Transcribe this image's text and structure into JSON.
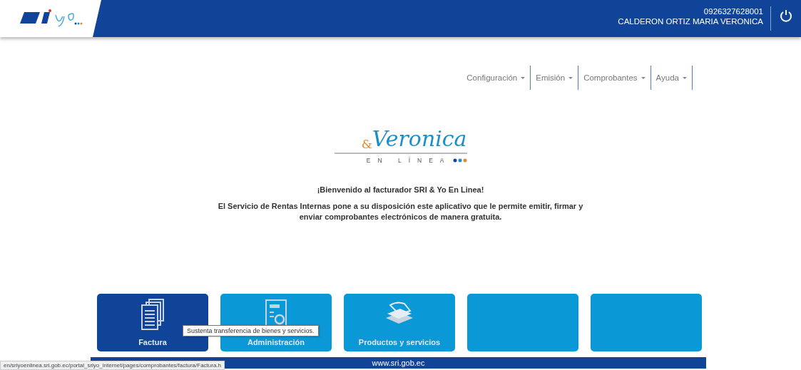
{
  "header": {
    "ruc": "0926327628001",
    "user_name": "CALDERON ORTIZ MARIA VERONICA"
  },
  "menu": [
    {
      "label": "Configuración"
    },
    {
      "label": "Emisión"
    },
    {
      "label": "Comprobantes"
    },
    {
      "label": "Ayuda"
    }
  ],
  "logo": {
    "amp": "&",
    "name": "Veronica",
    "tagline": "EN LÍNEA"
  },
  "welcome": {
    "title": "¡Bienvenido al facturador SRI & Yo En Linea!",
    "text": "El Servicio de Rentas Internas pone a su disposición este aplicativo que le permite emitir, firmar y enviar comprobantes electrónicos de manera gratuita."
  },
  "tiles": [
    {
      "kind": "documents",
      "label": "Factura",
      "selected": true
    },
    {
      "kind": "admin",
      "label": "Administración",
      "selected": false
    },
    {
      "kind": "papers",
      "label": "Productos y servicios",
      "selected": false
    },
    {
      "kind": "empty",
      "selected": false
    },
    {
      "kind": "empty",
      "selected": false
    }
  ],
  "tooltip": "Sustenta transferencia de bienes y servicios.",
  "footer": "www.sri.gob.ec",
  "status_url": "en/sriyoenlinea.sri.gob.ec/portal_sriyo_internet/pages/comprobantes/factura/Factura.h"
}
